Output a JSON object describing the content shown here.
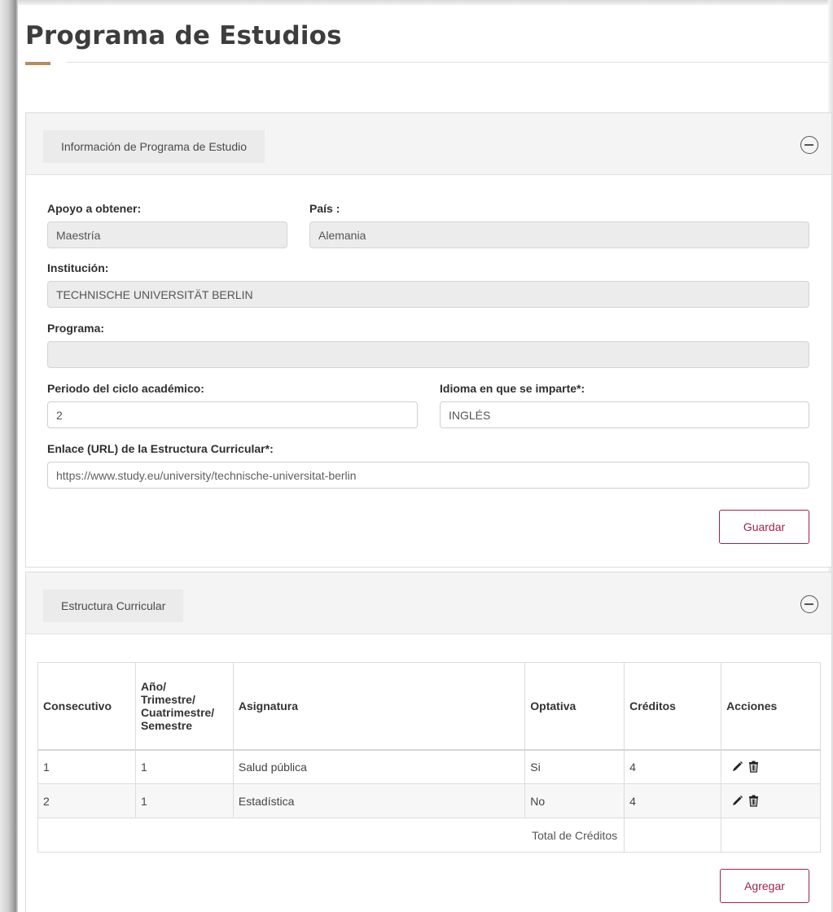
{
  "page": {
    "title": "Programa de Estudios"
  },
  "section_info": {
    "tab_label": "Información de Programa de Estudio",
    "fields": {
      "apoyo_label": "Apoyo a obtener:",
      "apoyo_value": "Maestría",
      "pais_label": "País :",
      "pais_value": "Alemania",
      "institucion_label": "Institución:",
      "institucion_value": "TECHNISCHE UNIVERSITÄT BERLIN",
      "programa_label": "Programa:",
      "programa_value": "",
      "periodo_label": "Periodo del ciclo académico:",
      "periodo_value": "2",
      "idioma_label": "Idioma en que se imparte*:",
      "idioma_value": "INGLÉS",
      "enlace_label": "Enlace (URL) de la Estructura Curricular*:",
      "enlace_value": "https://www.study.eu/university/technische-universitat-berlin"
    },
    "save_label": "Guardar"
  },
  "section_curricular": {
    "tab_label": "Estructura Curricular",
    "table": {
      "headers": {
        "consecutivo": "Consecutivo",
        "periodo_line1": "Año/",
        "periodo_line2": "Trimestre/",
        "periodo_line3": "Cuatrimestre/",
        "periodo_line4": "Semestre",
        "asignatura": "Asignatura",
        "optativa": "Optativa",
        "creditos": "Créditos",
        "acciones": "Acciones"
      },
      "rows": [
        {
          "consecutivo": "1",
          "periodo": "1",
          "asignatura": "Salud pública",
          "optativa": "Si",
          "creditos": "4"
        },
        {
          "consecutivo": "2",
          "periodo": "1",
          "asignatura": "Estadística",
          "optativa": "No",
          "creditos": "4"
        }
      ],
      "total_label": "Total de Créditos",
      "total_value": ""
    },
    "add_label": "Agregar"
  },
  "colors": {
    "accent": "#9d2449",
    "gold": "#b38e5d"
  },
  "icons": [
    "minus-circle-icon",
    "pencil-icon",
    "trash-icon"
  ]
}
